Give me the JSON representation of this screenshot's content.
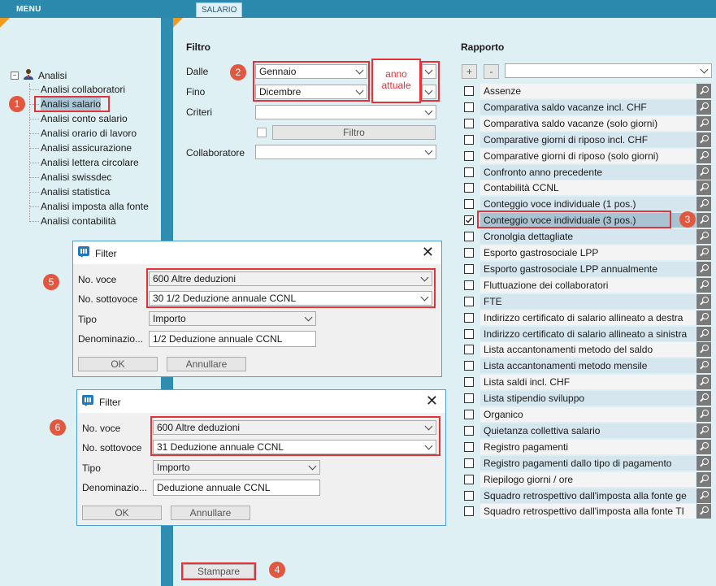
{
  "menu_title": "MENU",
  "tab_label": "SALARIO",
  "tree": {
    "root": "Analisi",
    "items": [
      "Analisi collaboratori",
      "Analisi salario",
      "Analisi conto salario",
      "Analisi orario di lavoro",
      "Analisi assicurazione",
      "Analisi lettera circolare",
      "Analisi swissdec",
      "Analisi statistica",
      "Analisi imposta alla fonte",
      "Analisi contabilità"
    ]
  },
  "filtro": {
    "title": "Filtro",
    "dalle_label": "Dalle",
    "dalle_value": "Gennaio",
    "fino_label": "Fino",
    "fino_value": "Dicembre",
    "anno_note": "anno attuale",
    "criteri_label": "Criteri",
    "filtro_button": "Filtro",
    "collaboratore_label": "Collaboratore"
  },
  "rapporto": {
    "title": "Rapporto",
    "plus": "+",
    "minus": "-",
    "items": [
      {
        "label": "Assenze",
        "checked": false
      },
      {
        "label": "Comparativa saldo vacanze incl. CHF",
        "checked": false
      },
      {
        "label": "Comparativa saldo vacanze (solo giorni)",
        "checked": false
      },
      {
        "label": "Comparative giorni di riposo incl. CHF",
        "checked": false
      },
      {
        "label": "Comparative giorni di riposo (solo giorni)",
        "checked": false
      },
      {
        "label": "Confronto anno precedente",
        "checked": false
      },
      {
        "label": "Contabilità CCNL",
        "checked": false
      },
      {
        "label": "Conteggio voce individuale (1 pos.)",
        "checked": false
      },
      {
        "label": "Conteggio voce individuale (3 pos.)",
        "checked": true
      },
      {
        "label": "Cronolgia dettagliate",
        "checked": false
      },
      {
        "label": "Esporto gastrosociale LPP",
        "checked": false
      },
      {
        "label": "Esporto gastrosociale LPP annualmente",
        "checked": false
      },
      {
        "label": "Fluttuazione dei collaboratori",
        "checked": false
      },
      {
        "label": "FTE",
        "checked": false
      },
      {
        "label": "Indirizzo certificato di salario allineato a destra",
        "checked": false
      },
      {
        "label": "Indirizzo certificato di salario allineato a sinistra",
        "checked": false
      },
      {
        "label": "Lista accantonamenti metodo del saldo",
        "checked": false
      },
      {
        "label": "Lista accantonamenti metodo mensile",
        "checked": false
      },
      {
        "label": "Lista saldi incl. CHF",
        "checked": false
      },
      {
        "label": "Lista stipendio sviluppo",
        "checked": false
      },
      {
        "label": "Organico",
        "checked": false
      },
      {
        "label": "Quietanza collettiva salario",
        "checked": false
      },
      {
        "label": "Registro pagamenti",
        "checked": false
      },
      {
        "label": "Registro pagamenti dallo tipo di pagamento",
        "checked": false
      },
      {
        "label": "Riepilogo giorni / ore",
        "checked": false
      },
      {
        "label": "Squadro retrospettivo dall'imposta alla fonte ge",
        "checked": false
      },
      {
        "label": "Squadro retrospettivo dall'imposta alla fonte TI",
        "checked": false
      }
    ]
  },
  "stampare_button": "Stampare",
  "dialog1": {
    "title": "Filter",
    "close": "✕",
    "voce_label": "No. voce",
    "voce_value": "600 Altre deduzioni",
    "sottovoce_label": "No. sottovoce",
    "sottovoce_value": "30 1/2 Deduzione annuale CCNL",
    "tipo_label": "Tipo",
    "tipo_value": "Importo",
    "denom_label": "Denominazio...",
    "denom_value": "1/2 Deduzione annuale CCNL",
    "ok": "OK",
    "cancel": "Annullare"
  },
  "dialog2": {
    "title": "Filter",
    "close": "✕",
    "voce_label": "No. voce",
    "voce_value": "600 Altre deduzioni",
    "sottovoce_label": "No. sottovoce",
    "sottovoce_value": "31 Deduzione annuale CCNL",
    "tipo_label": "Tipo",
    "tipo_value": "Importo",
    "denom_label": "Denominazio...",
    "denom_value": "Deduzione annuale CCNL",
    "ok": "OK",
    "cancel": "Annullare"
  },
  "badges": [
    "1",
    "2",
    "3",
    "4",
    "5",
    "6"
  ],
  "colors": {
    "badge": "#e2573f",
    "highlight": "#e2323a",
    "accent": "#f39a1e",
    "chrome": "#2f8db1"
  }
}
